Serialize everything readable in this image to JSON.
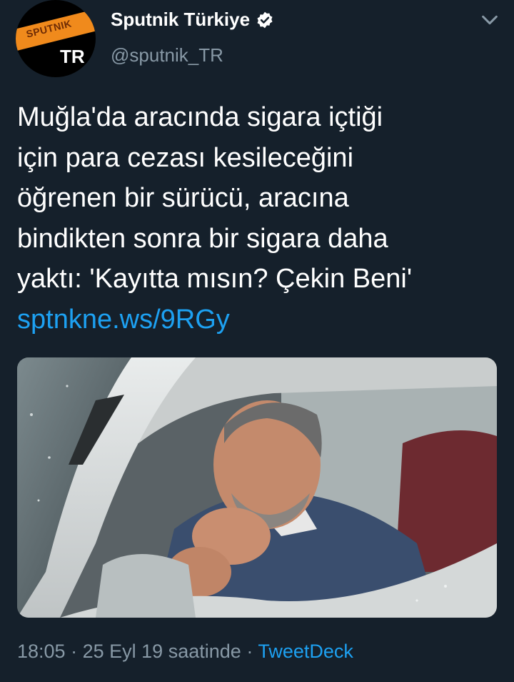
{
  "account": {
    "display_name": "Sputnik Türkiye",
    "handle": "@sputnik_TR",
    "verified": true,
    "avatar": {
      "logo_text": "SPUTNIK",
      "region_text": "TR",
      "colors": {
        "background": "#000000",
        "stripe": "#f08a1c"
      }
    }
  },
  "tweet": {
    "text_lines": [
      "Muğla'da aracında sigara içtiği",
      "için para cezası kesileceğini",
      "öğrenen bir sürücü, aracına",
      "bindikten sonra bir sigara daha",
      "yaktı: 'Kayıtta mısın? Çekin Beni'"
    ],
    "link": "sptnkne.ws/9RGy"
  },
  "meta": {
    "time": "18:05",
    "separator": "·",
    "date": "25 Eyl 19",
    "suffix": "saatinde",
    "source": "TweetDeck"
  },
  "colors": {
    "background": "#15202b",
    "text": "#ffffff",
    "secondary": "#8899a6",
    "accent": "#1da1f2"
  },
  "icons": [
    "verified-badge-icon",
    "chevron-down-icon"
  ]
}
